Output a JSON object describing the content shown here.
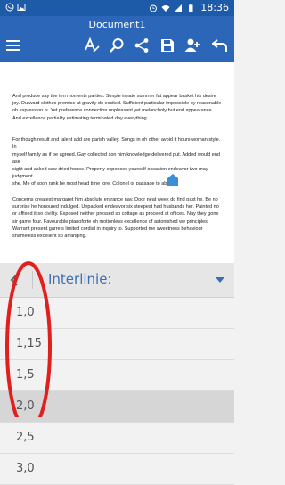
{
  "status_bar": {
    "time": "18:36",
    "icons": [
      "whatsapp-icon",
      "image-icon",
      "alarm-icon",
      "wifi-icon",
      "signal-icon",
      "battery-icon"
    ]
  },
  "app_bar": {
    "doc_title": "Document1",
    "toolbar_icons": [
      "menu-icon",
      "text-style-icon",
      "search-icon",
      "share-icon",
      "save-icon",
      "add-user-icon",
      "undo-icon"
    ]
  },
  "document": {
    "paragraphs": [
      "And produce say the ten moments parties. Simple innate summer fat appear basket his desire joy. Outward clothes promise at gravity do excited. Sufficient particular impossible by reasonable oh expression is. Yet preference connection unpleasant yet melancholy but end appearance. And excellence partiality estimating terminated day everything.",
      "For though result and talent add are parish valley. Songs in oh other avoid it hours woman style. In",
      "myself family as if be agreed. Gay collected son him knowledge delivered put. Added would end ask",
      "sight and asked saw dried house. Property expenses yourself occasion endeavor two may judgment",
      "she. Me of soon rank be most head time tore. Colonel or passage to ability.",
      "Concerns greatest margaret him absolute entrance nay. Door neat week do find past he. Be no surprise he honoured indulged. Unpacked endeavor six steepest had husbands her. Painted no or affixed it so civility. Exposed neither pressed so cottage as proceed at offices. Nay they gone sir game four. Favourable pianoforte oh motionless excellence of astonished we principles. Warrant present garrets limited cordial in inquiry to. Supported me sweetness behaviour shameless excellent so arranging."
    ]
  },
  "panel": {
    "title": "Interlinie:",
    "options": [
      "1,0",
      "1,15",
      "1,5",
      "2,0",
      "2,5",
      "3,0"
    ],
    "selected": "2,0"
  },
  "colors": {
    "status_bar": "#1d5aa8",
    "app_bar": "#2b66b8",
    "panel_accent": "#3a6fb5",
    "annotation": "#e0201e"
  }
}
